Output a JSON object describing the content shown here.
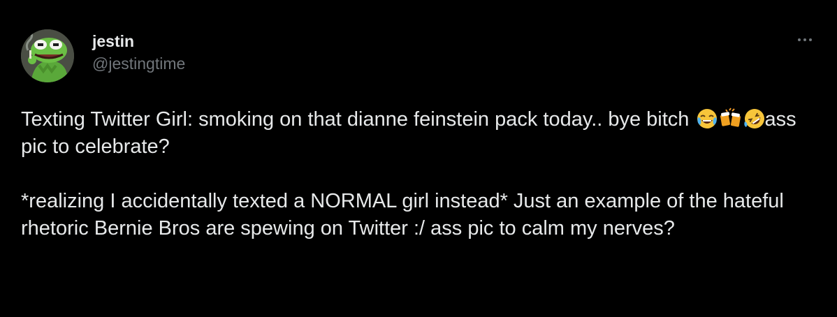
{
  "user": {
    "display_name": "jestin",
    "handle": "@jestingtime"
  },
  "tweet": {
    "line1_text": "Texting Twitter Girl: smoking on that dianne feinstein pack today.. bye bitch ",
    "emojis": [
      "face-with-tears-of-joy",
      "clinking-beer-mugs",
      "rolling-on-the-floor-laughing"
    ],
    "line1_after": "ass pic to celebrate?",
    "paragraph2": "*realizing I accidentally texted a NORMAL girl instead* Just an example of the hateful rhetoric Bernie Bros are spewing on Twitter :/ ass pic to calm my nerves?"
  },
  "icons": {
    "more": "more-horizontal-icon"
  },
  "colors": {
    "background": "#000000",
    "text_primary": "#e7e9ea",
    "text_secondary": "#71767b"
  }
}
